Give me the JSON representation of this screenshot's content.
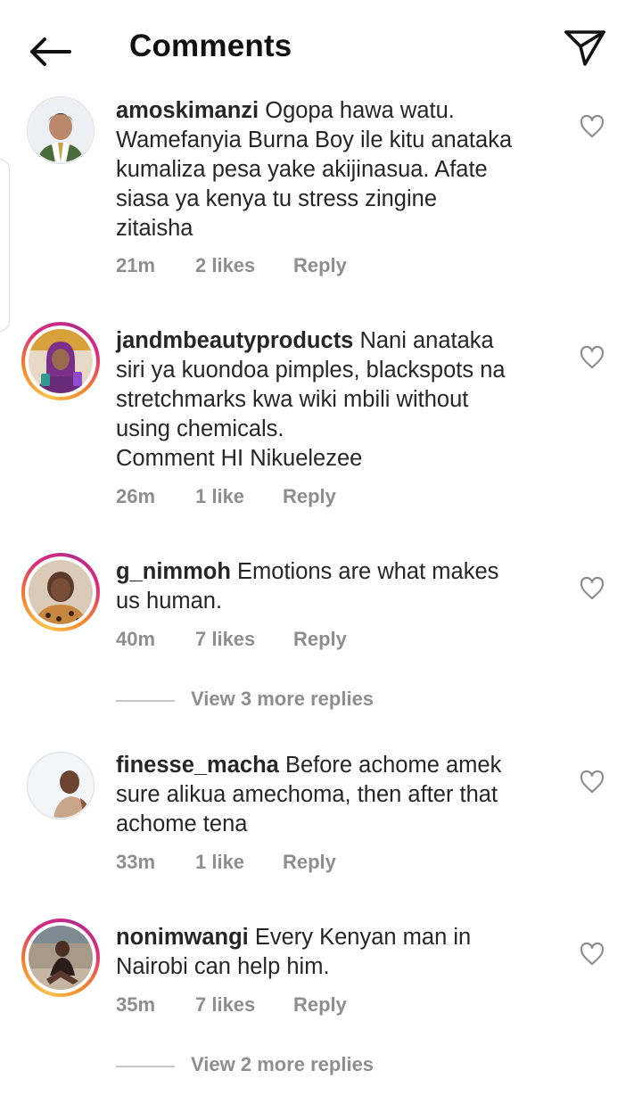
{
  "header": {
    "title": "Comments",
    "back_icon": "arrow-left-icon",
    "share_icon": "paper-plane-icon"
  },
  "colors": {
    "text": "#262626",
    "muted": "#8e8e8e",
    "ring_gradient": [
      "#f9c24a",
      "#f58529",
      "#dd2a7b",
      "#b52a8f"
    ]
  },
  "comments": [
    {
      "username": "amoskimanzi",
      "text": " Ogopa hawa watu.\nWamefanyia Burna Boy ile kitu anataka\nkumaliza pesa yake akijinasua. Afate\nsiasa ya kenya tu stress  zingine\nzitaisha",
      "time": "21m",
      "likes": "2 likes",
      "reply": "Reply",
      "has_story_ring": false
    },
    {
      "username": "jandmbeautyproducts",
      "text": " Nani anataka\nsiri ya kuondoa pimples, blackspots na\nstretchmarks kwa wiki mbili without\nusing chemicals.\nComment HI Nikuelezee",
      "time": "26m",
      "likes": "1 like",
      "reply": "Reply",
      "has_story_ring": true
    },
    {
      "username": "g_nimmoh",
      "text": " Emotions are what makes\nus human.",
      "time": "40m",
      "likes": "7 likes",
      "reply": "Reply",
      "has_story_ring": true,
      "view_replies": "View 3 more replies"
    },
    {
      "username": "finesse_macha",
      "text": " Before achome amek\nsure alikua amechoma, then after that\nachome tena",
      "time": "33m",
      "likes": "1 like",
      "reply": "Reply",
      "has_story_ring": false
    },
    {
      "username": "nonimwangi",
      "text": " Every Kenyan man in\nNairobi can help him.",
      "time": "35m",
      "likes": "7 likes",
      "reply": "Reply",
      "has_story_ring": true,
      "view_replies": "View 2 more replies"
    }
  ]
}
